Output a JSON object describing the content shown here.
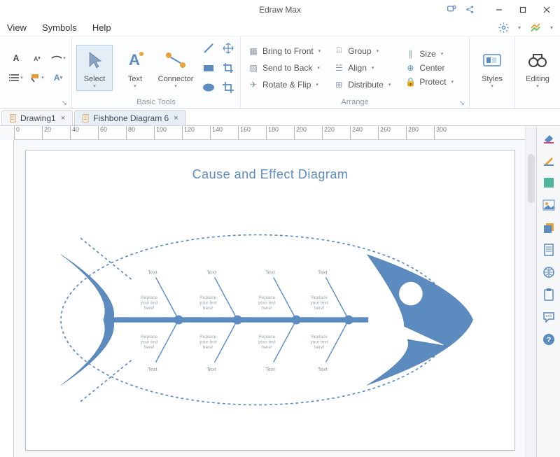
{
  "app_title": "Edraw Max",
  "menus": {
    "view": "View",
    "symbols": "Symbols",
    "help": "Help"
  },
  "ribbon": {
    "basic_tools_label": "Basic Tools",
    "arrange_label": "Arrange",
    "select": "Select",
    "text": "Text",
    "connector": "Connector",
    "bring_to_front": "Bring to Front",
    "send_to_back": "Send to Back",
    "rotate_flip": "Rotate & Flip",
    "group": "Group",
    "align": "Align",
    "distribute": "Distribute",
    "size": "Size",
    "center": "Center",
    "protect": "Protect",
    "styles": "Styles",
    "editing": "Editing"
  },
  "tabs": {
    "drawing1": "Drawing1",
    "fishbone": "Fishbone Diagram 6"
  },
  "ruler": [
    "0",
    "20",
    "40",
    "60",
    "80",
    "100",
    "120",
    "140",
    "160",
    "180",
    "200",
    "220",
    "240",
    "260",
    "280",
    "300"
  ],
  "diagram": {
    "title": "Cause and Effect Diagram",
    "bone_label": "Text",
    "cause_label": "Replace\nyour text\nhere!"
  }
}
